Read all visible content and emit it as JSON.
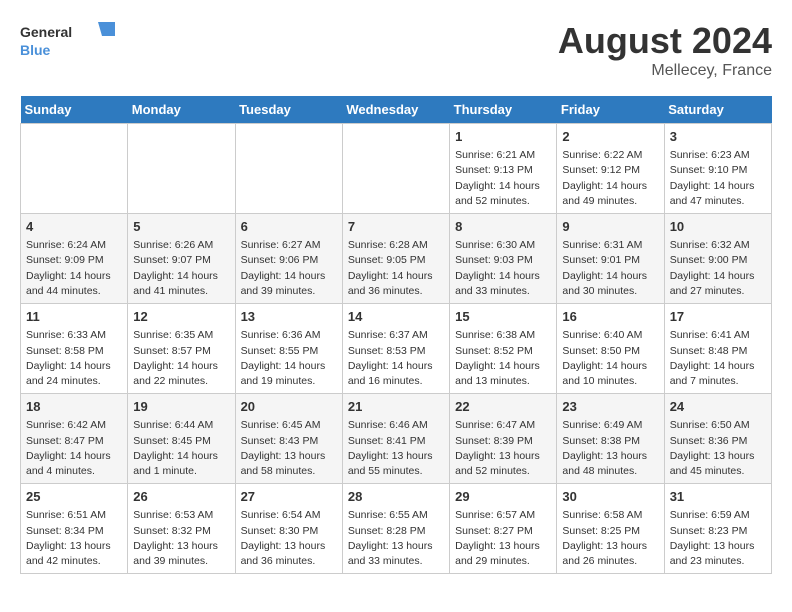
{
  "header": {
    "logo_line1": "General",
    "logo_line2": "Blue",
    "month": "August 2024",
    "location": "Mellecey, France"
  },
  "weekdays": [
    "Sunday",
    "Monday",
    "Tuesday",
    "Wednesday",
    "Thursday",
    "Friday",
    "Saturday"
  ],
  "weeks": [
    [
      {
        "day": "",
        "info": ""
      },
      {
        "day": "",
        "info": ""
      },
      {
        "day": "",
        "info": ""
      },
      {
        "day": "",
        "info": ""
      },
      {
        "day": "1",
        "info": "Sunrise: 6:21 AM\nSunset: 9:13 PM\nDaylight: 14 hours\nand 52 minutes."
      },
      {
        "day": "2",
        "info": "Sunrise: 6:22 AM\nSunset: 9:12 PM\nDaylight: 14 hours\nand 49 minutes."
      },
      {
        "day": "3",
        "info": "Sunrise: 6:23 AM\nSunset: 9:10 PM\nDaylight: 14 hours\nand 47 minutes."
      }
    ],
    [
      {
        "day": "4",
        "info": "Sunrise: 6:24 AM\nSunset: 9:09 PM\nDaylight: 14 hours\nand 44 minutes."
      },
      {
        "day": "5",
        "info": "Sunrise: 6:26 AM\nSunset: 9:07 PM\nDaylight: 14 hours\nand 41 minutes."
      },
      {
        "day": "6",
        "info": "Sunrise: 6:27 AM\nSunset: 9:06 PM\nDaylight: 14 hours\nand 39 minutes."
      },
      {
        "day": "7",
        "info": "Sunrise: 6:28 AM\nSunset: 9:05 PM\nDaylight: 14 hours\nand 36 minutes."
      },
      {
        "day": "8",
        "info": "Sunrise: 6:30 AM\nSunset: 9:03 PM\nDaylight: 14 hours\nand 33 minutes."
      },
      {
        "day": "9",
        "info": "Sunrise: 6:31 AM\nSunset: 9:01 PM\nDaylight: 14 hours\nand 30 minutes."
      },
      {
        "day": "10",
        "info": "Sunrise: 6:32 AM\nSunset: 9:00 PM\nDaylight: 14 hours\nand 27 minutes."
      }
    ],
    [
      {
        "day": "11",
        "info": "Sunrise: 6:33 AM\nSunset: 8:58 PM\nDaylight: 14 hours\nand 24 minutes."
      },
      {
        "day": "12",
        "info": "Sunrise: 6:35 AM\nSunset: 8:57 PM\nDaylight: 14 hours\nand 22 minutes."
      },
      {
        "day": "13",
        "info": "Sunrise: 6:36 AM\nSunset: 8:55 PM\nDaylight: 14 hours\nand 19 minutes."
      },
      {
        "day": "14",
        "info": "Sunrise: 6:37 AM\nSunset: 8:53 PM\nDaylight: 14 hours\nand 16 minutes."
      },
      {
        "day": "15",
        "info": "Sunrise: 6:38 AM\nSunset: 8:52 PM\nDaylight: 14 hours\nand 13 minutes."
      },
      {
        "day": "16",
        "info": "Sunrise: 6:40 AM\nSunset: 8:50 PM\nDaylight: 14 hours\nand 10 minutes."
      },
      {
        "day": "17",
        "info": "Sunrise: 6:41 AM\nSunset: 8:48 PM\nDaylight: 14 hours\nand 7 minutes."
      }
    ],
    [
      {
        "day": "18",
        "info": "Sunrise: 6:42 AM\nSunset: 8:47 PM\nDaylight: 14 hours\nand 4 minutes."
      },
      {
        "day": "19",
        "info": "Sunrise: 6:44 AM\nSunset: 8:45 PM\nDaylight: 14 hours\nand 1 minute."
      },
      {
        "day": "20",
        "info": "Sunrise: 6:45 AM\nSunset: 8:43 PM\nDaylight: 13 hours\nand 58 minutes."
      },
      {
        "day": "21",
        "info": "Sunrise: 6:46 AM\nSunset: 8:41 PM\nDaylight: 13 hours\nand 55 minutes."
      },
      {
        "day": "22",
        "info": "Sunrise: 6:47 AM\nSunset: 8:39 PM\nDaylight: 13 hours\nand 52 minutes."
      },
      {
        "day": "23",
        "info": "Sunrise: 6:49 AM\nSunset: 8:38 PM\nDaylight: 13 hours\nand 48 minutes."
      },
      {
        "day": "24",
        "info": "Sunrise: 6:50 AM\nSunset: 8:36 PM\nDaylight: 13 hours\nand 45 minutes."
      }
    ],
    [
      {
        "day": "25",
        "info": "Sunrise: 6:51 AM\nSunset: 8:34 PM\nDaylight: 13 hours\nand 42 minutes."
      },
      {
        "day": "26",
        "info": "Sunrise: 6:53 AM\nSunset: 8:32 PM\nDaylight: 13 hours\nand 39 minutes."
      },
      {
        "day": "27",
        "info": "Sunrise: 6:54 AM\nSunset: 8:30 PM\nDaylight: 13 hours\nand 36 minutes."
      },
      {
        "day": "28",
        "info": "Sunrise: 6:55 AM\nSunset: 8:28 PM\nDaylight: 13 hours\nand 33 minutes."
      },
      {
        "day": "29",
        "info": "Sunrise: 6:57 AM\nSunset: 8:27 PM\nDaylight: 13 hours\nand 29 minutes."
      },
      {
        "day": "30",
        "info": "Sunrise: 6:58 AM\nSunset: 8:25 PM\nDaylight: 13 hours\nand 26 minutes."
      },
      {
        "day": "31",
        "info": "Sunrise: 6:59 AM\nSunset: 8:23 PM\nDaylight: 13 hours\nand 23 minutes."
      }
    ]
  ]
}
